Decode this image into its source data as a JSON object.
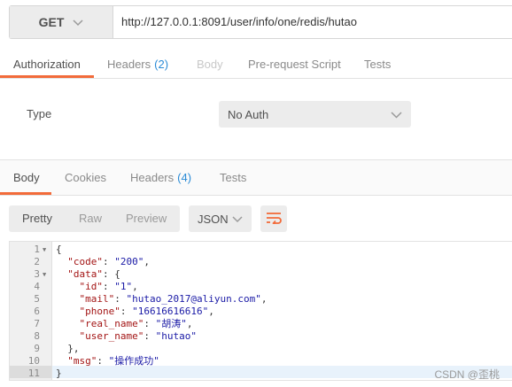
{
  "request": {
    "method": "GET",
    "url": "http://127.0.0.1:8091/user/info/one/redis/hutao"
  },
  "request_tabs": [
    {
      "label": "Authorization",
      "count": "",
      "state": "active"
    },
    {
      "label": "Headers",
      "count": "(2)",
      "state": "normal"
    },
    {
      "label": "Body",
      "count": "",
      "state": "disabled"
    },
    {
      "label": "Pre-request Script",
      "count": "",
      "state": "normal"
    },
    {
      "label": "Tests",
      "count": "",
      "state": "normal"
    }
  ],
  "auth": {
    "type_label": "Type",
    "type_value": "No Auth"
  },
  "response_tabs": [
    {
      "label": "Body",
      "count": "",
      "state": "active"
    },
    {
      "label": "Cookies",
      "count": "",
      "state": "normal"
    },
    {
      "label": "Headers",
      "count": "(4)",
      "state": "normal"
    },
    {
      "label": "Tests",
      "count": "",
      "state": "normal"
    }
  ],
  "view_modes": [
    "Pretty",
    "Raw",
    "Preview"
  ],
  "active_view_mode": "Pretty",
  "format": "JSON",
  "icons": {
    "method_dropdown": "chevron-down-icon",
    "format_dropdown": "chevron-down-icon",
    "auth_dropdown": "chevron-down-icon",
    "wrap": "wrap-lines-icon"
  },
  "colors": {
    "accent": "#f26b3a",
    "count": "#2a8bd6",
    "json_key": "#a31515",
    "json_string": "#1a1aa6"
  },
  "code": {
    "line_numbers": [
      "1",
      "2",
      "3",
      "4",
      "5",
      "6",
      "7",
      "8",
      "9",
      "10",
      "11"
    ],
    "lines": [
      "{",
      "  \"code\": \"200\",",
      "  \"data\": {",
      "    \"id\": \"1\",",
      "    \"mail\": \"hutao_2017@aliyun.com\",",
      "    \"phone\": \"16616616616\",",
      "    \"real_name\": \"胡涛\",",
      "    \"user_name\": \"hutao\"",
      "  },",
      "  \"msg\": \"操作成功\"",
      "}"
    ],
    "foldable_lines": [
      "1",
      "3"
    ],
    "current_line": "11"
  },
  "watermark": "CSDN @歪桃"
}
